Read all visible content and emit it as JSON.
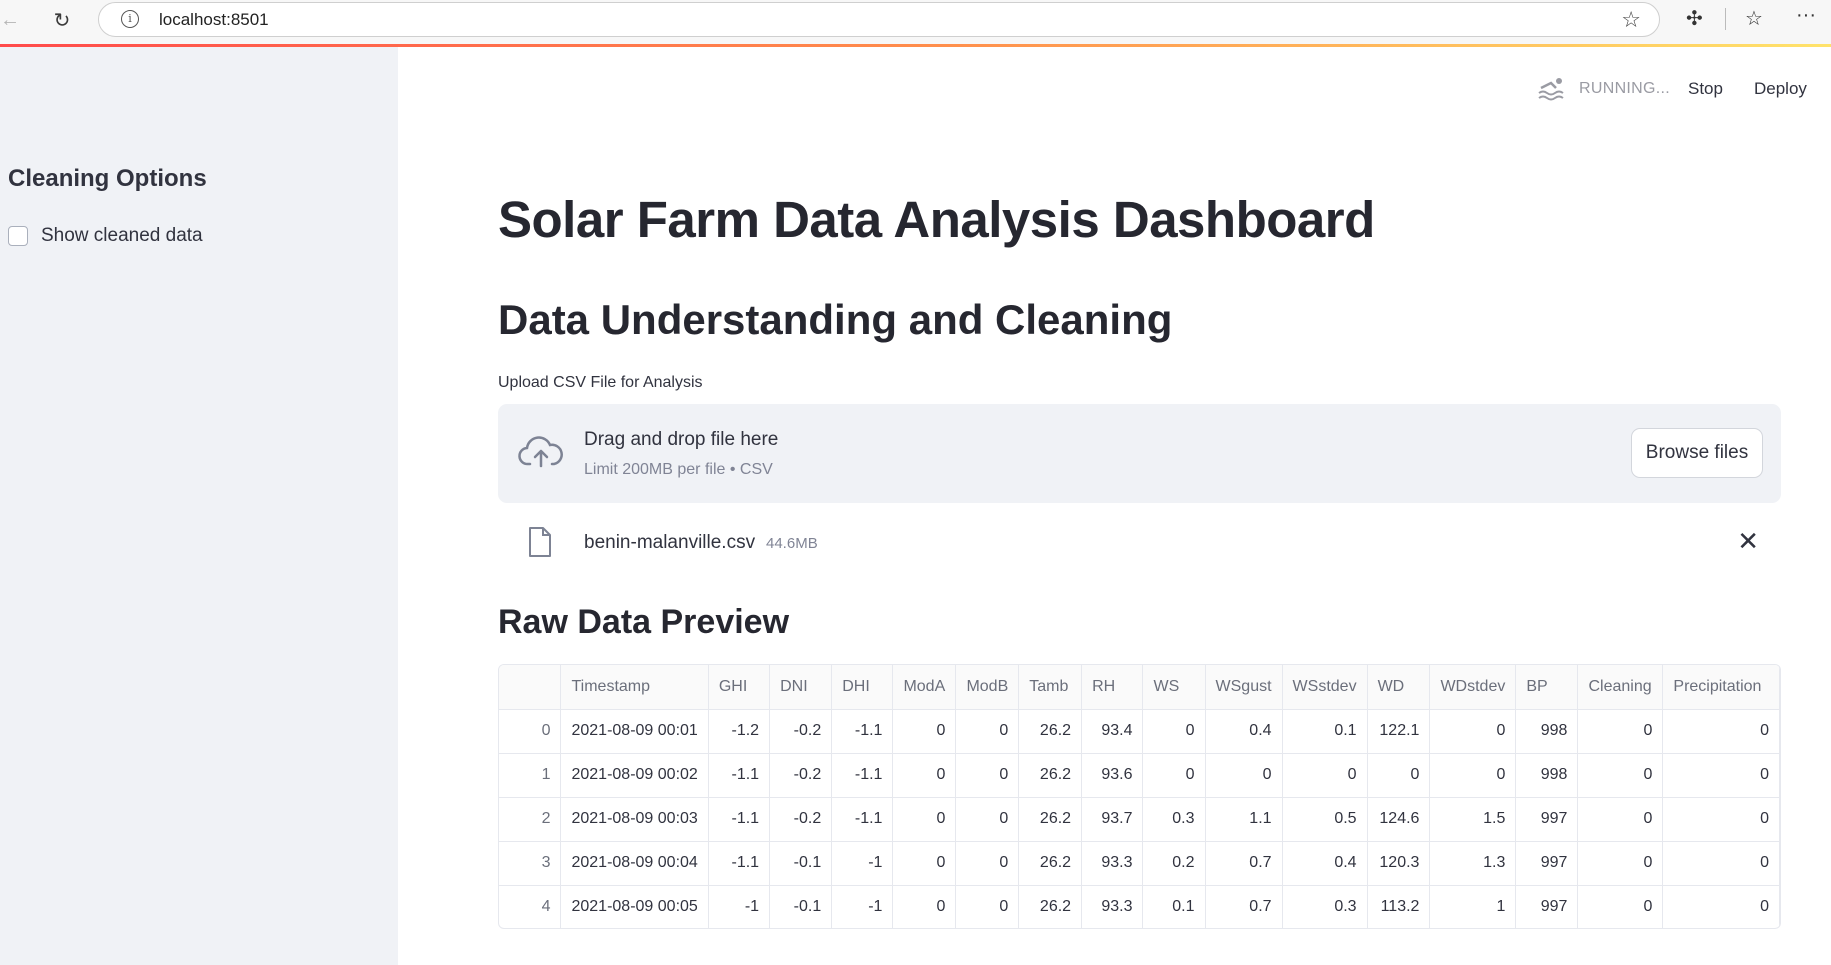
{
  "browser": {
    "url": "localhost:8501"
  },
  "sidebar": {
    "heading": "Cleaning Options",
    "checkbox_label": "Show cleaned data"
  },
  "header": {
    "status": "RUNNING...",
    "stop_label": "Stop",
    "deploy_label": "Deploy"
  },
  "main": {
    "title": "Solar Farm Data Analysis Dashboard",
    "subtitle": "Data Understanding and Cleaning",
    "upload_label": "Upload CSV File for Analysis",
    "dropzone_text": "Drag and drop file here",
    "dropzone_limit": "Limit 200MB per file • CSV",
    "browse_label": "Browse files",
    "file_name": "benin-malanville.csv",
    "file_size": "44.6MB",
    "preview_title": "Raw Data Preview"
  },
  "table": {
    "columns": [
      "",
      "Timestamp",
      "GHI",
      "DNI",
      "DHI",
      "ModA",
      "ModB",
      "Tamb",
      "RH",
      "WS",
      "WSgust",
      "WSstdev",
      "WD",
      "WDstdev",
      "BP",
      "Cleaning",
      "Precipitation"
    ],
    "rows": [
      [
        "0",
        "2021-08-09 00:01",
        "-1.2",
        "-0.2",
        "-1.1",
        "0",
        "0",
        "26.2",
        "93.4",
        "0",
        "0.4",
        "0.1",
        "122.1",
        "0",
        "998",
        "0",
        "0"
      ],
      [
        "1",
        "2021-08-09 00:02",
        "-1.1",
        "-0.2",
        "-1.1",
        "0",
        "0",
        "26.2",
        "93.6",
        "0",
        "0",
        "0",
        "0",
        "0",
        "998",
        "0",
        "0"
      ],
      [
        "2",
        "2021-08-09 00:03",
        "-1.1",
        "-0.2",
        "-1.1",
        "0",
        "0",
        "26.2",
        "93.7",
        "0.3",
        "1.1",
        "0.5",
        "124.6",
        "1.5",
        "997",
        "0",
        "0"
      ],
      [
        "3",
        "2021-08-09 00:04",
        "-1.1",
        "-0.1",
        "-1",
        "0",
        "0",
        "26.2",
        "93.3",
        "0.2",
        "0.7",
        "0.4",
        "120.3",
        "1.3",
        "997",
        "0",
        "0"
      ],
      [
        "4",
        "2021-08-09 00:05",
        "-1",
        "-0.1",
        "-1",
        "0",
        "0",
        "26.2",
        "93.3",
        "0.1",
        "0.7",
        "0.3",
        "113.2",
        "1",
        "997",
        "0",
        "0"
      ]
    ]
  }
}
